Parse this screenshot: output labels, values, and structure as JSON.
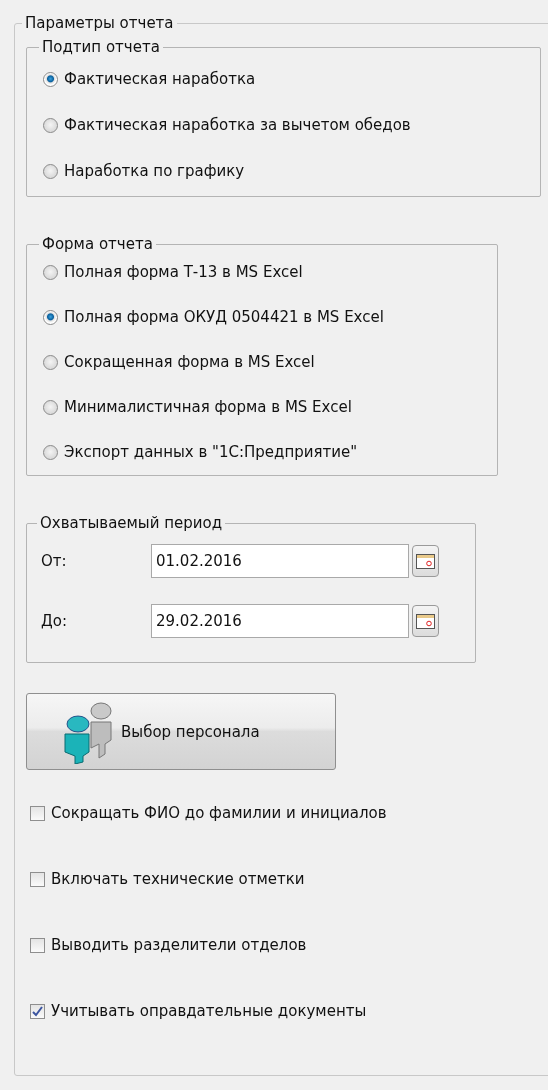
{
  "panel": {
    "title": "Параметры отчета",
    "subtype": {
      "title": "Подтип отчета",
      "options": [
        {
          "label": "Фактическая наработка",
          "selected": true
        },
        {
          "label": "Фактическая наработка за вычетом обедов",
          "selected": false
        },
        {
          "label": "Наработка по графику",
          "selected": false
        }
      ]
    },
    "form": {
      "title": "Форма отчета",
      "options": [
        {
          "label": "Полная форма Т-13 в MS Excel",
          "selected": false
        },
        {
          "label": "Полная форма ОКУД 0504421 в MS Excel",
          "selected": true
        },
        {
          "label": "Сокращенная форма в MS Excel",
          "selected": false
        },
        {
          "label": "Минималистичная форма в MS Excel",
          "selected": false
        },
        {
          "label": "Экспорт данных в \"1С:Предприятие\"",
          "selected": false
        }
      ]
    },
    "period": {
      "title": "Охватываемый период",
      "fields": [
        {
          "label": "От:",
          "value": "01.02.2016"
        },
        {
          "label": "До:",
          "value": "29.02.2016"
        }
      ]
    },
    "staff_button": "Выбор персонала",
    "checkboxes": [
      {
        "label": "Сокращать ФИО до фамилии и инициалов",
        "checked": false
      },
      {
        "label": "Включать технические отметки",
        "checked": false
      },
      {
        "label": "Выводить разделители отделов",
        "checked": false
      },
      {
        "label": "Учитывать оправдательные документы",
        "checked": true
      }
    ]
  }
}
